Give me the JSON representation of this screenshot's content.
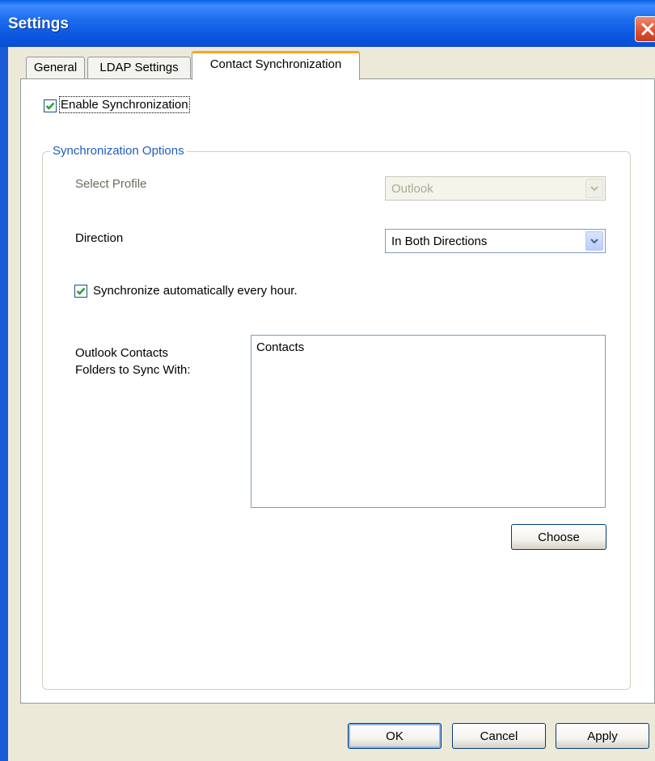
{
  "window": {
    "title": "Settings"
  },
  "tabs": [
    {
      "label": "General"
    },
    {
      "label": "LDAP Settings"
    },
    {
      "label": "Contact Synchronization",
      "active": true
    }
  ],
  "enable_sync": {
    "label": "Enable Synchronization",
    "checked": true
  },
  "options_group": {
    "legend": "Synchronization Options",
    "select_profile": {
      "label": "Select Profile",
      "value": "Outlook",
      "disabled": true
    },
    "direction": {
      "label": "Direction",
      "value": "In Both Directions"
    },
    "auto_sync": {
      "label": "Synchronize automatically every hour.",
      "checked": true
    },
    "folders": {
      "label_line1": "Outlook Contacts",
      "label_line2": "Folders to Sync With:",
      "items": [
        "Contacts"
      ]
    },
    "choose_label": "Choose"
  },
  "footer": {
    "ok_label": "OK",
    "cancel_label": "Cancel",
    "apply_label": "Apply"
  },
  "colors": {
    "titlebar": "#0A56DA",
    "dialog_bg": "#ECE9D8",
    "legend": "#1F5CBF",
    "tab_highlight": "#F5A623",
    "checkmark": "#21A121"
  },
  "icons": {
    "close": "close-icon",
    "checkbox": "check-icon",
    "dropdown": "chevron-down-icon"
  }
}
